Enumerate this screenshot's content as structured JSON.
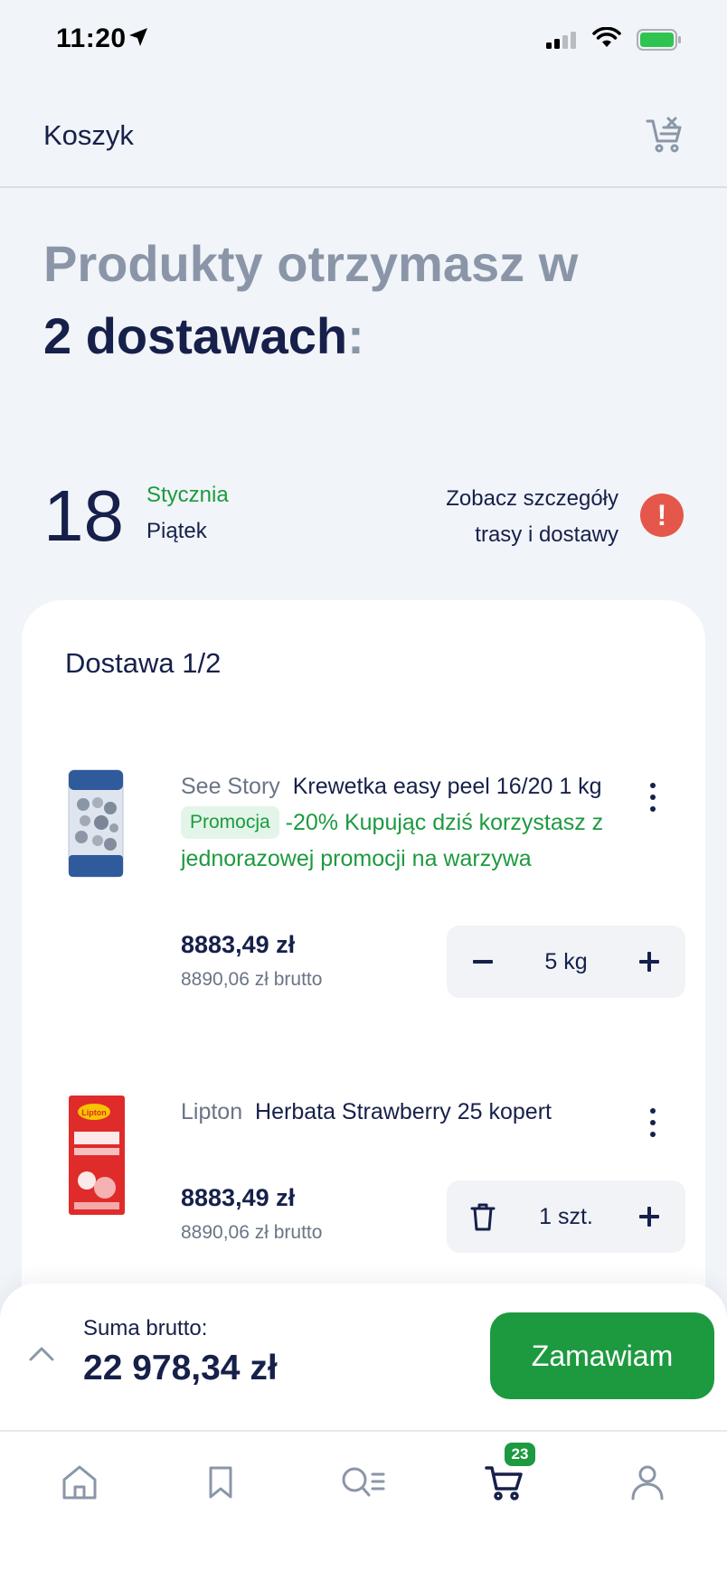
{
  "status_bar": {
    "time": "11:20"
  },
  "header": {
    "title": "Koszyk"
  },
  "headline": {
    "line1": "Produkty otrzymasz w",
    "line2_bold": "2 dostawach",
    "line2_colon": ":"
  },
  "delivery_date": {
    "day": "18",
    "month": "Stycznia",
    "weekday": "Piątek",
    "route_link_line1": "Zobacz szczegóły",
    "route_link_line2": "trasy i dostawy",
    "alert_glyph": "!"
  },
  "delivery": {
    "title": "Dostawa 1/2",
    "items": [
      {
        "brand": "See Story",
        "name": "Krewetka easy peel 16/20",
        "unit": "1 kg",
        "promo_badge": "Promocja",
        "promo_text": "-20% Kupując dziś korzystasz z jednorazowej promocji na warzywa",
        "price": "8883,49 zł",
        "price_brutto": "8890,06 zł brutto",
        "qty": "5 kg",
        "left_button": "minus-icon"
      },
      {
        "brand": "Lipton",
        "name": "Herbata Strawberry 25 kopert",
        "price": "8883,49 zł",
        "price_brutto": "8890,06 zł brutto",
        "qty": "1 szt.",
        "left_button": "trash-icon"
      }
    ]
  },
  "summary": {
    "label": "Suma brutto:",
    "value": "22 978,34 zł",
    "button": "Zamawiam"
  },
  "tabbar": {
    "cart_badge": "23",
    "active_tab": "cart"
  },
  "colors": {
    "accent_green": "#1d9a3f",
    "navy": "#16204a",
    "grey_text": "#8a96a8",
    "alert_red": "#e5574a",
    "background": "#f1f4f8"
  }
}
